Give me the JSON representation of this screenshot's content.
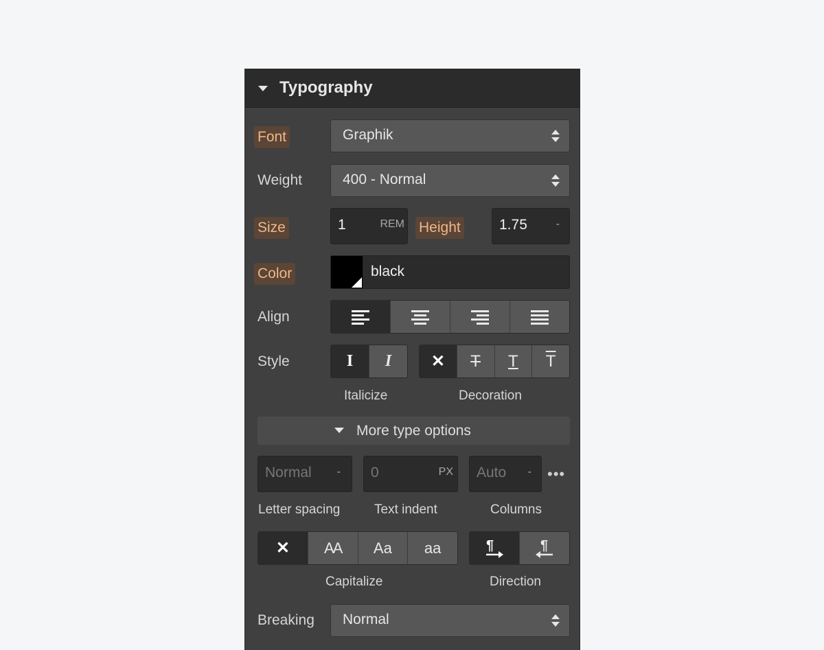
{
  "panel": {
    "title": "Typography"
  },
  "font": {
    "label": "Font",
    "value": "Graphik"
  },
  "weight": {
    "label": "Weight",
    "value": "400 - Normal"
  },
  "size": {
    "label": "Size",
    "value": "1",
    "unit": "REM"
  },
  "height": {
    "label": "Height",
    "value": "1.75",
    "unit": "-"
  },
  "color": {
    "label": "Color",
    "value": "black",
    "swatch": "#000000"
  },
  "align": {
    "label": "Align",
    "options": [
      "align-left-icon",
      "align-center-icon",
      "align-right-icon",
      "align-justify-icon"
    ],
    "selected": 0
  },
  "style": {
    "label": "Style",
    "italicize": {
      "label": "Italicize",
      "options": [
        "I",
        "I"
      ]
    },
    "decoration": {
      "label": "Decoration",
      "options": [
        "✕",
        "T",
        "T",
        "T"
      ]
    }
  },
  "more_options": {
    "label": "More type options"
  },
  "letter_spacing": {
    "label": "Letter spacing",
    "placeholder": "Normal",
    "unit": "-"
  },
  "text_indent": {
    "label": "Text indent",
    "placeholder": "0",
    "unit": "PX"
  },
  "columns": {
    "label": "Columns",
    "placeholder": "Auto",
    "unit": "-",
    "more": "•••"
  },
  "capitalize": {
    "label": "Capitalize",
    "options": [
      "✕",
      "AA",
      "Aa",
      "aa"
    ]
  },
  "direction": {
    "label": "Direction",
    "options": [
      "ltr-icon",
      "rtl-icon"
    ]
  },
  "breaking": {
    "label": "Breaking",
    "value": "Normal"
  },
  "colors": {
    "accent_label_bg": "#5a4536",
    "accent_label_text": "#f0b787",
    "panel_bg": "#404040"
  }
}
